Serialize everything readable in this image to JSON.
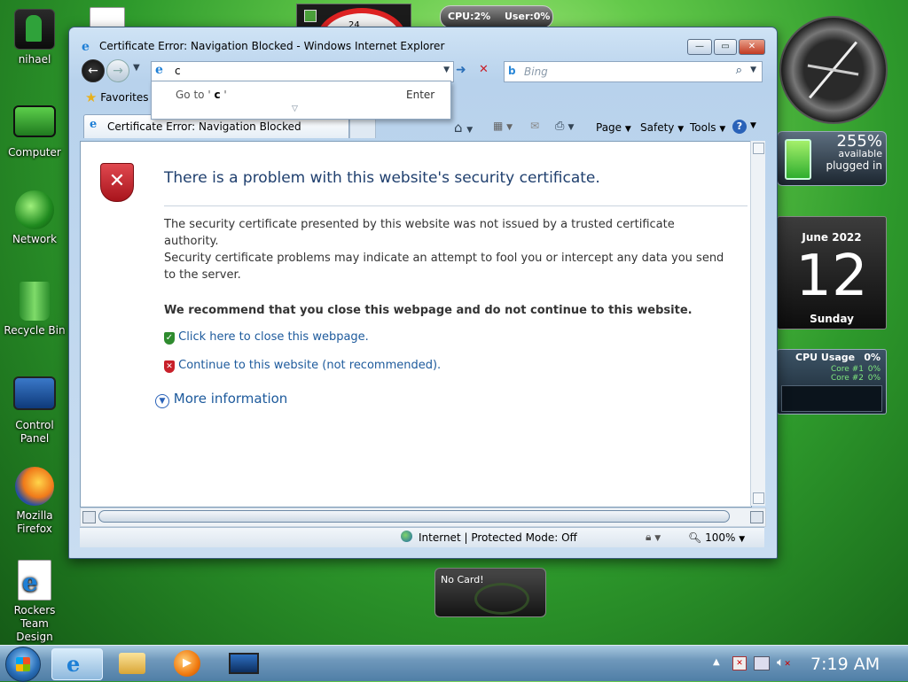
{
  "desktop": {
    "icons": [
      {
        "label": "nihael"
      },
      {
        "label": "Computer"
      },
      {
        "label": "Network"
      },
      {
        "label": "Recycle Bin"
      },
      {
        "label": "Control Panel"
      },
      {
        "label": "Mozilla\nFirefox"
      },
      {
        "label": "Rockers Team\nDesign Studio"
      }
    ]
  },
  "gadgets": {
    "cpu_meter": {
      "cpu": "CPU:2%",
      "user": "User:0%"
    },
    "battery": {
      "percent": "255%",
      "line1": "available",
      "line2": "plugged in"
    },
    "calendar": {
      "month": "June 2022",
      "day": "12",
      "weekday": "Sunday"
    },
    "cpu_usage": {
      "title": "CPU Usage",
      "total": "0%",
      "core1_label": "Core #1",
      "core1": "0%",
      "core2_label": "Core #2",
      "core2": "0%"
    },
    "nvidia": {
      "text": "No Card!"
    },
    "clock_number": "24"
  },
  "window": {
    "title": "Certificate Error: Navigation Blocked - Windows Internet Explorer",
    "address_value": "c",
    "search_placeholder": "Bing",
    "autocomplete": {
      "goto_prefix": "Go to '",
      "goto_value": "c",
      "goto_suffix": "'",
      "enter_label": "Enter"
    },
    "favorites_label": "Favorites",
    "tab_label": "Certificate Error: Navigation Blocked",
    "toolbar": {
      "page": "Page",
      "safety": "Safety",
      "tools": "Tools"
    },
    "content": {
      "heading": "There is a problem with this website's security certificate.",
      "para1": "The security certificate presented by this website was not issued by a trusted certificate authority.",
      "para2": "Security certificate problems may indicate an attempt to fool you or intercept any data you send to the server.",
      "recommend": "We recommend that you close this webpage and do not continue to this website.",
      "close_link": "Click here to close this webpage.",
      "continue_link": "Continue to this website (not recommended).",
      "more_info": "More information"
    },
    "status": {
      "zone": "Internet | Protected Mode: Off",
      "zoom": "100%"
    }
  },
  "taskbar": {
    "time": "7:19 AM"
  },
  "colors": {
    "accent": "#1d5a9c",
    "danger": "#c8202a",
    "safe": "#2e8b2e"
  }
}
